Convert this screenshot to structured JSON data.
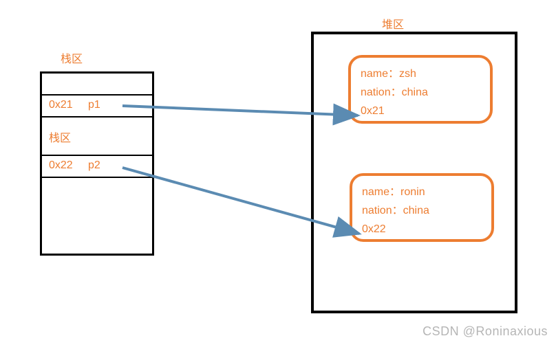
{
  "stack": {
    "title": "栈区",
    "inner_label": "栈区",
    "rows": [
      {
        "addr": "0x21",
        "var": "p1"
      },
      {
        "addr": "0x22",
        "var": "p2"
      }
    ]
  },
  "heap": {
    "title": "堆区",
    "objects": [
      {
        "name_label": "name：",
        "name_value": "zsh",
        "nation_label": "nation：",
        "nation_value": "china",
        "addr": "0x21"
      },
      {
        "name_label": "name：",
        "name_value": "ronin",
        "nation_label": "nation：",
        "nation_value": "china",
        "addr": "0x22"
      }
    ]
  },
  "watermark": "CSDN @Roninaxious"
}
